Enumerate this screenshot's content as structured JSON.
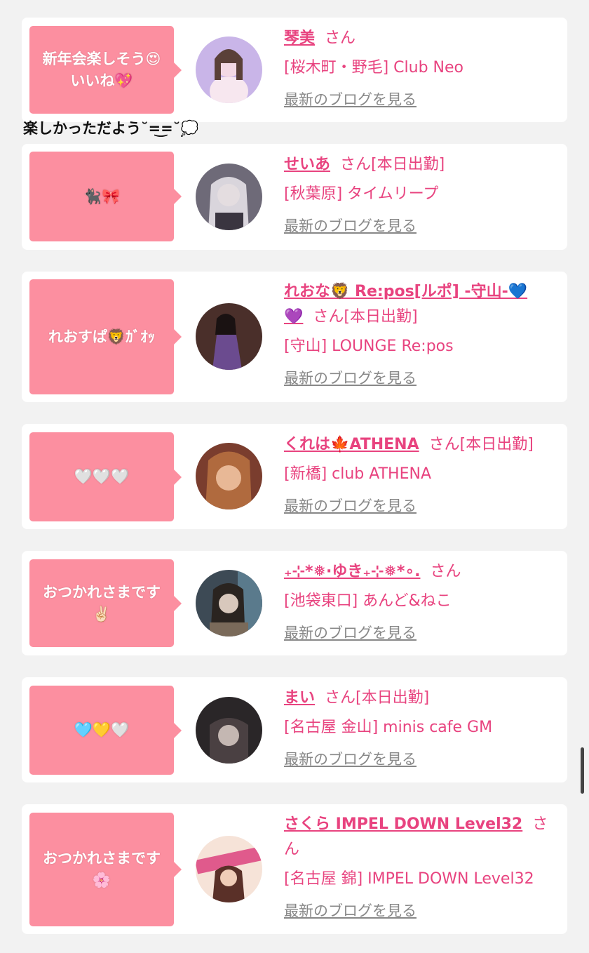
{
  "floating_caption": "楽しかっただよう˘=͜=˘💭",
  "cards": [
    {
      "comment_line1": "新年会楽しそう😍",
      "comment_line2": "いいね💖",
      "name": "琴美",
      "suffix": "さん",
      "status": "",
      "shop": "[桜木町・野毛] Club Neo",
      "blog_link": "最新のブログを見る",
      "avatar_bg": "#c9b5e8",
      "avatar_fg": "#f3d9e4"
    },
    {
      "comment_line1": "🐈‍⬛🎀",
      "comment_line2": "",
      "name": "せいあ",
      "suffix": "さん",
      "status": "[本日出勤]",
      "shop": "[秋葉原] タイムリープ",
      "blog_link": "最新のブログを見る",
      "avatar_bg": "#6e6a78",
      "avatar_fg": "#e4dde0"
    },
    {
      "comment_line1": "れおすぱ🦁ｶﾞｵｯ",
      "comment_line2": "",
      "name_line1": "れおな🦁 Re:pos[ルポ] -守山-💙",
      "name_line2": "💜",
      "suffix": "さん",
      "status": "[本日出勤]",
      "shop": "[守山] LOUNGE Re:pos",
      "blog_link": "最新のブログを見る",
      "avatar_bg": "#4a2f2a",
      "avatar_fg": "#6b4b8f"
    },
    {
      "comment_line1": "🤍🤍🤍",
      "comment_line2": "",
      "name": "くれは🍁ATHENA",
      "suffix": "さん",
      "status": "[本日出勤]",
      "shop": "[新橋] club ATHENA",
      "blog_link": "最新のブログを見る",
      "avatar_bg": "#7a3d2e",
      "avatar_fg": "#e8b896"
    },
    {
      "comment_line1": "おつかれさまです",
      "comment_line2": "✌🏻",
      "name": "₊⊹*❅·ゆき₊⊹❅*∘.",
      "suffix": "さん",
      "status": "",
      "shop": "[池袋東口] あんど&ねこ",
      "blog_link": "最新のブログを見る",
      "avatar_bg": "#3d4a55",
      "avatar_fg": "#d8c8bc"
    },
    {
      "comment_line1": "🩵💛🤍",
      "comment_line2": "",
      "name": "まい",
      "suffix": "さん",
      "status": "[本日出勤]",
      "shop": "[名古屋 金山] minis cafe GM",
      "blog_link": "最新のブログを見る",
      "avatar_bg": "#2a2628",
      "avatar_fg": "#c4b7b2"
    },
    {
      "comment_line1": "おつかれさまです",
      "comment_line2": "🌸",
      "name": "さくら IMPEL DOWN Level32",
      "suffix": "さ",
      "suffix2": "ん",
      "status": "",
      "shop": "[名古屋 錦] IMPEL DOWN Level32",
      "blog_link": "最新のブログを見る",
      "avatar_bg": "#e05a8c",
      "avatar_fg": "#f6e3d8"
    }
  ],
  "colors": {
    "accent": "#e8437f",
    "bubble": "#fc8fa0",
    "background": "#f2f2f2",
    "link_gray": "#888888"
  }
}
